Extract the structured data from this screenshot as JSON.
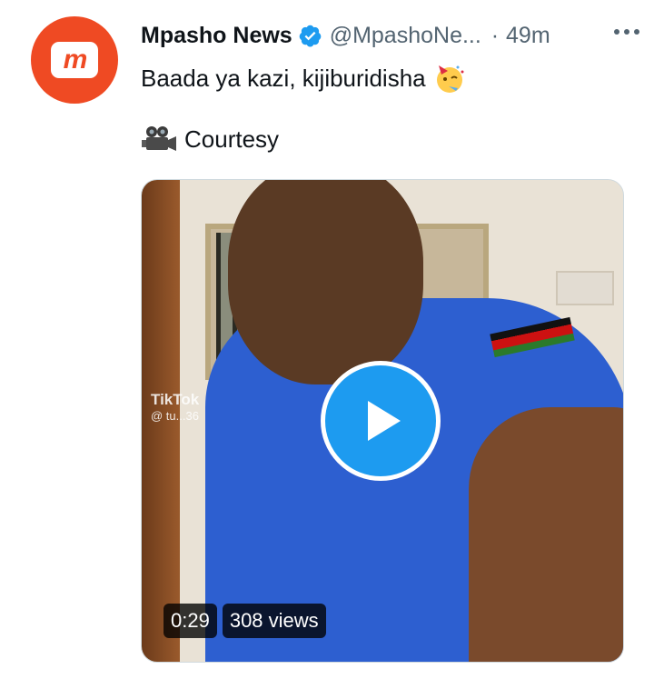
{
  "account": {
    "name": "Mpasho News",
    "handle": "@MpashoNe...",
    "separator": "·",
    "time": "49m",
    "avatar_text": "m",
    "brand_color": "#ef4a23",
    "verified_icon": "verified-badge-icon"
  },
  "tweet": {
    "text": "Baada ya kazi, kijiburidisha",
    "emoji": "partying-face-icon",
    "courtesy_label": "Courtesy",
    "courtesy_icon": "movie-camera-icon"
  },
  "video": {
    "duration": "0:29",
    "views": "308 views",
    "watermark": "TikTok",
    "watermark_user": "@ tu...36",
    "play_icon": "play-icon",
    "accent_color": "#1d9bf0"
  },
  "menu": {
    "icon": "more-icon"
  }
}
